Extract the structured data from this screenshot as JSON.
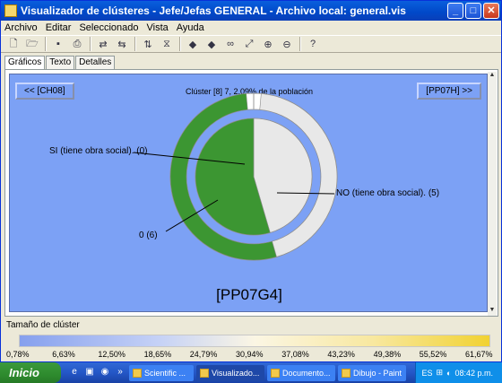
{
  "window": {
    "title": "Visualizador de clústeres - Jefe/Jefas GENERAL - Archivo local: general.vis"
  },
  "menu": [
    "Archivo",
    "Editar",
    "Seleccionado",
    "Vista",
    "Ayuda"
  ],
  "toolbar_icons": [
    "new-icon",
    "open-icon",
    "save-icon",
    "print-icon",
    "redo-icon",
    "undo-icon",
    "sort-icon",
    "filter-icon",
    "arrow-left-icon",
    "arrow-right-icon",
    "binoculars-icon",
    "zoom-icon",
    "zoom-in-icon",
    "zoom-out-icon",
    "help-icon"
  ],
  "tabs": [
    "Gráficos",
    "Texto",
    "Detalles"
  ],
  "nav": {
    "prev": "<< [CH08]",
    "next": "[PP07H] >>"
  },
  "cluster_title": "Clúster [8] 7, 2,09% de la población",
  "chart_data": {
    "type": "pie",
    "title": "[PP07G4]",
    "outer_ring": {
      "series": [
        {
          "label": "0",
          "value": 6,
          "color": "#3c9632"
        },
        {
          "label": "NO",
          "value": 5,
          "color": "#e8e8e8"
        },
        {
          "label": "SI",
          "value": 0,
          "color": "#ffffff"
        }
      ]
    },
    "inner_ring": {
      "series": [
        {
          "label": "0 (6)",
          "value": 6,
          "color": "#3c9632"
        },
        {
          "label": "NO (tiene obra social). (5)",
          "value": 5,
          "color": "#e8e8e8"
        },
        {
          "label": "SI (tiene obra social). (0)",
          "value": 0,
          "color": "#ffffff"
        }
      ]
    },
    "labels": {
      "si": "SI (tiene obra social). (0)",
      "no": "NO (tiene obra social). (5)",
      "zero": "0 (6)"
    }
  },
  "size_legend": {
    "label": "Tamaño de clúster",
    "ticks": [
      "0,78%",
      "6,63%",
      "12,50%",
      "18,65%",
      "24,79%",
      "30,94%",
      "37,08%",
      "43,23%",
      "49,38%",
      "55,52%",
      "61,67%"
    ]
  },
  "taskbar": {
    "start": "Inicio",
    "tasks": [
      "Scientific ...",
      "Visualizado...",
      "Documento...",
      "Dibujo - Paint"
    ],
    "tray_lang": "ES",
    "clock": "08:42 p.m."
  }
}
